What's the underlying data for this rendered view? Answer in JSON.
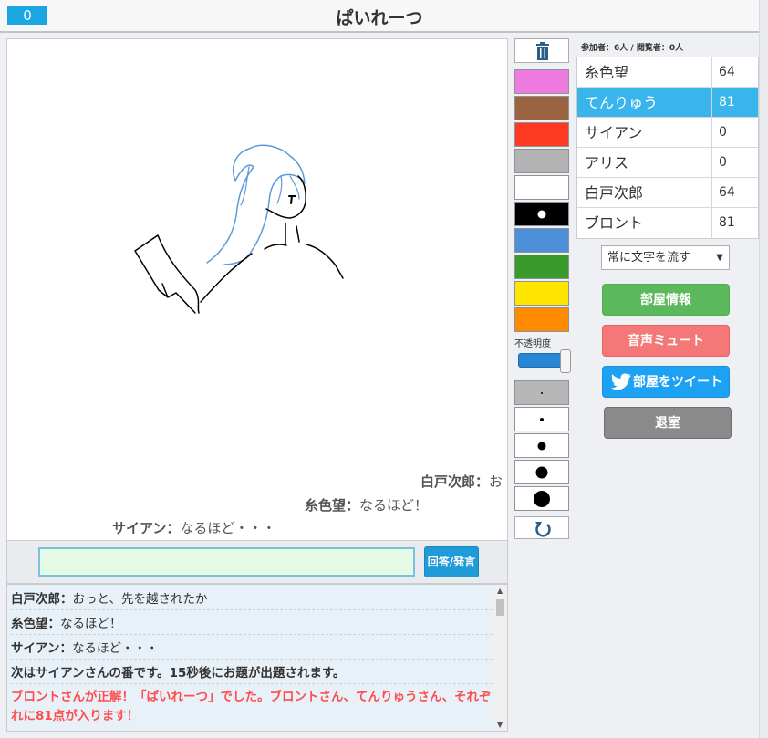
{
  "header": {
    "round": "0",
    "title": "ぱいれーつ"
  },
  "canvas_flow": [
    {
      "name": "白戸次郎",
      "sep": "：",
      "text": "お"
    },
    {
      "name": "糸色望",
      "sep": "：",
      "text": "なるほど！"
    },
    {
      "name": "サイアン",
      "sep": "：",
      "text": "なるほど・・・"
    }
  ],
  "answer": {
    "value": "",
    "button_label": "回答/発言"
  },
  "chat": [
    {
      "name": "白戸次郎",
      "sep": "：",
      "text": "おっと、先を越されたか"
    },
    {
      "name": "糸色望",
      "sep": "：",
      "text": "なるほど！"
    },
    {
      "name": "サイアン",
      "sep": "：",
      "text": "なるほど・・・"
    },
    {
      "system": "次はサイアンさんの番です。15秒後にお題が出題されます。"
    },
    {
      "correct": "ブロントさんが正解！「ぱいれーつ」でした。ブロントさん、てんりゅうさん、それぞれに81点が入ります！"
    }
  ],
  "tools": {
    "trash_icon": "trash-icon",
    "colors": [
      "#ef7ae0",
      "#9b6440",
      "#ff3a22",
      "#b3b3b3",
      "#ffffff",
      "#000000",
      "#4d8fd8",
      "#3a9a2a",
      "#ffe600",
      "#ff8a00"
    ],
    "selected_color": "#000000",
    "opacity_label": "不透明度",
    "opacity_value": 1.0,
    "pen_sizes": [
      2,
      4,
      9,
      13,
      18
    ],
    "selected_pen": 0,
    "undo_icon": "undo-icon"
  },
  "participants": {
    "label": "参加者：6人 / 閲覧者：0人"
  },
  "players": [
    {
      "name": "糸色望",
      "score": "64",
      "active": false
    },
    {
      "name": "てんりゅう",
      "score": "81",
      "active": true
    },
    {
      "name": "サイアン",
      "score": "0",
      "active": false
    },
    {
      "name": "アリス",
      "score": "0",
      "active": false
    },
    {
      "name": "白戸次郎",
      "score": "64",
      "active": false
    },
    {
      "name": "ブロント",
      "score": "81",
      "active": false
    }
  ],
  "options": {
    "flow_select": "常に文字を流す"
  },
  "buttons": {
    "room_info": "部屋情報",
    "mute": "音声ミュート",
    "tweet": "部屋をツイート",
    "exit": "退室"
  },
  "colors": {
    "accent": "#39b5ec",
    "correct_text": "#ff4d4d"
  }
}
